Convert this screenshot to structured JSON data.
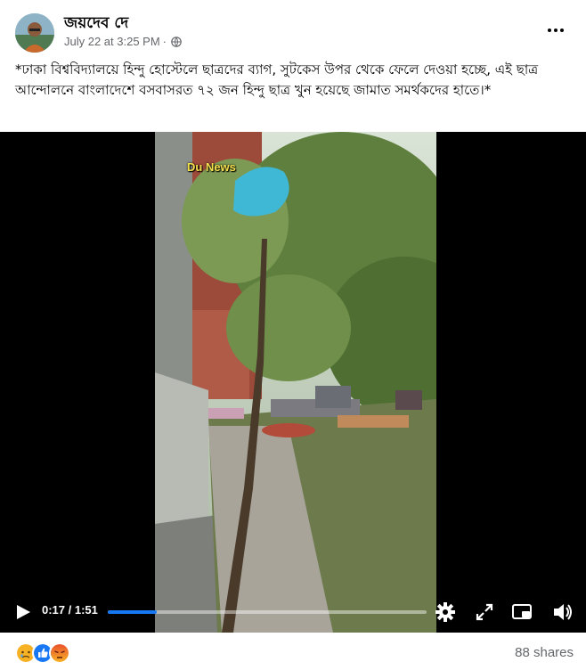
{
  "post": {
    "author": "জয়দেব দে",
    "timestamp": "July 22 at 3:25 PM",
    "separator": "·",
    "privacy_icon": "globe-icon",
    "more_icon": "more-options-icon",
    "caption": "*ঢাকা বিশ্ববিদ্যালয়ে হিন্দু হোস্টেলে ছাত্রদের ব্যাগ, সুটকেস উপর থেকে ফেলে দেওয়া হচ্ছে, এই ছাত্র আন্দোলনে বাংলাদেশে বসবাসরত ৭২ জন হিন্দু ছাত্র খুন হয়েছে জামাত সমর্থকদের হাতে।*"
  },
  "video": {
    "watermark": "Du News",
    "current_time": "0:17",
    "time_sep": " / ",
    "duration": "1:51",
    "progress_fraction": 0.153,
    "controls": [
      "play-icon",
      "settings-icon",
      "fullscreen-icon",
      "picture-in-picture-icon",
      "volume-icon"
    ]
  },
  "footer": {
    "reactions": [
      "sad-icon",
      "like-icon",
      "angry-icon"
    ],
    "shares": "88 shares"
  },
  "colors": {
    "accent": "#1877f2",
    "secondary_text": "#65676b",
    "watermark": "#f4e04d"
  }
}
